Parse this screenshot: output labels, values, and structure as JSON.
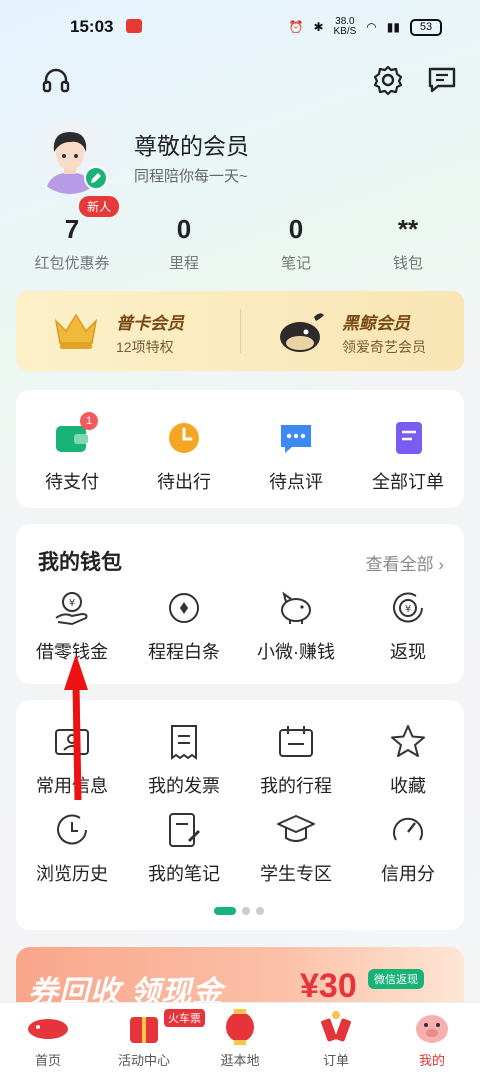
{
  "status_bar": {
    "time": "15:03",
    "net_speed_top": "38.0",
    "net_speed_unit": "KB/S",
    "battery": "53"
  },
  "profile": {
    "name": "尊敬的会员",
    "slogan": "同程陪你每一天~",
    "new_badge": "新人"
  },
  "stats": [
    {
      "value": "7",
      "label": "红包优惠券"
    },
    {
      "value": "0",
      "label": "里程"
    },
    {
      "value": "0",
      "label": "笔记"
    },
    {
      "value": "**",
      "label": "钱包"
    }
  ],
  "membership": {
    "left": {
      "title": "普卡会员",
      "subtitle": "12项特权"
    },
    "right": {
      "title": "黑鲸会员",
      "subtitle": "领爱奇艺会员"
    }
  },
  "orders": [
    {
      "label": "待支付",
      "badge": "1",
      "icon": "wallet-icon"
    },
    {
      "label": "待出行",
      "icon": "clock-icon"
    },
    {
      "label": "待点评",
      "icon": "chat-icon"
    },
    {
      "label": "全部订单",
      "icon": "document-icon"
    }
  ],
  "wallet": {
    "title": "我的钱包",
    "view_all": "查看全部",
    "items": [
      {
        "label": "借零钱金",
        "icon": "loan-icon"
      },
      {
        "label": "程程白条",
        "icon": "credit-icon"
      },
      {
        "label": "小微·赚钱",
        "icon": "piggy-bank-icon"
      },
      {
        "label": "返现",
        "icon": "cashback-icon"
      }
    ]
  },
  "tools": {
    "row1": [
      {
        "label": "常用信息",
        "icon": "id-card-icon"
      },
      {
        "label": "我的发票",
        "icon": "receipt-icon"
      },
      {
        "label": "我的行程",
        "icon": "calendar-icon"
      },
      {
        "label": "收藏",
        "icon": "star-icon"
      }
    ],
    "row2": [
      {
        "label": "浏览历史",
        "icon": "history-icon"
      },
      {
        "label": "我的笔记",
        "icon": "note-icon"
      },
      {
        "label": "学生专区",
        "icon": "graduation-icon"
      },
      {
        "label": "信用分",
        "icon": "gauge-icon"
      }
    ]
  },
  "promo": {
    "headline": "券回收 领现金",
    "amount": "¥30",
    "tag": "微信返现"
  },
  "tabbar": [
    {
      "label": "首页",
      "icon": "whale-icon"
    },
    {
      "label": "活动中心",
      "icon": "gift-icon",
      "tag": "火车票"
    },
    {
      "label": "逛本地",
      "icon": "lantern-icon"
    },
    {
      "label": "订单",
      "icon": "firecracker-icon"
    },
    {
      "label": "我的",
      "icon": "pig-icon",
      "active": true
    }
  ],
  "colors": {
    "accent_green": "#19b277",
    "accent_red": "#e5343a",
    "gold": "#7a4a14"
  }
}
